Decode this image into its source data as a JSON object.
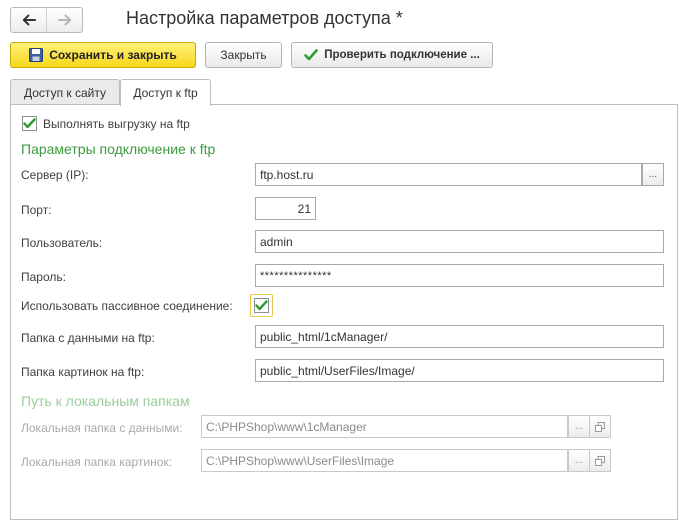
{
  "window": {
    "title": "Настройка параметров доступа *"
  },
  "toolbar": {
    "save_close": "Сохранить и закрыть",
    "close": "Закрыть",
    "check": "Проверить подключение ..."
  },
  "tabs": [
    {
      "label": "Доступ к сайту",
      "active": false
    },
    {
      "label": "Доступ к ftp",
      "active": true
    }
  ],
  "form": {
    "upload_ftp": {
      "label": "Выполнять выгрузку на ftp",
      "checked": true
    },
    "section_connection": "Параметры подключение к ftp",
    "server": {
      "label": "Сервер (IP):",
      "value": "ftp.host.ru",
      "button": "..."
    },
    "port": {
      "label": "Порт:",
      "value": "21"
    },
    "user": {
      "label": "Пользователь:",
      "value": "admin"
    },
    "password": {
      "label": "Пароль:",
      "value": "***************"
    },
    "passive": {
      "label": "Использовать пассивное соединение:",
      "checked": true
    },
    "data_folder": {
      "label": "Папка с данными на ftp:",
      "value": "public_html/1cManager/"
    },
    "images_folder": {
      "label": "Папка картинок на ftp:",
      "value": "public_html/UserFiles/Image/"
    },
    "section_local": "Путь к локальным папкам",
    "local_data": {
      "label": "Локальная папка с данными:",
      "value": "C:\\PHPShop\\www\\1cManager",
      "button": "..."
    },
    "local_images": {
      "label": "Локальная папка картинок:",
      "value": "C:\\PHPShop\\www\\UserFiles\\Image",
      "button": "..."
    }
  },
  "colors": {
    "accent_yellow": "#f7d61a",
    "section_green": "#3c9a3c",
    "check_green": "#2e9c2e"
  }
}
